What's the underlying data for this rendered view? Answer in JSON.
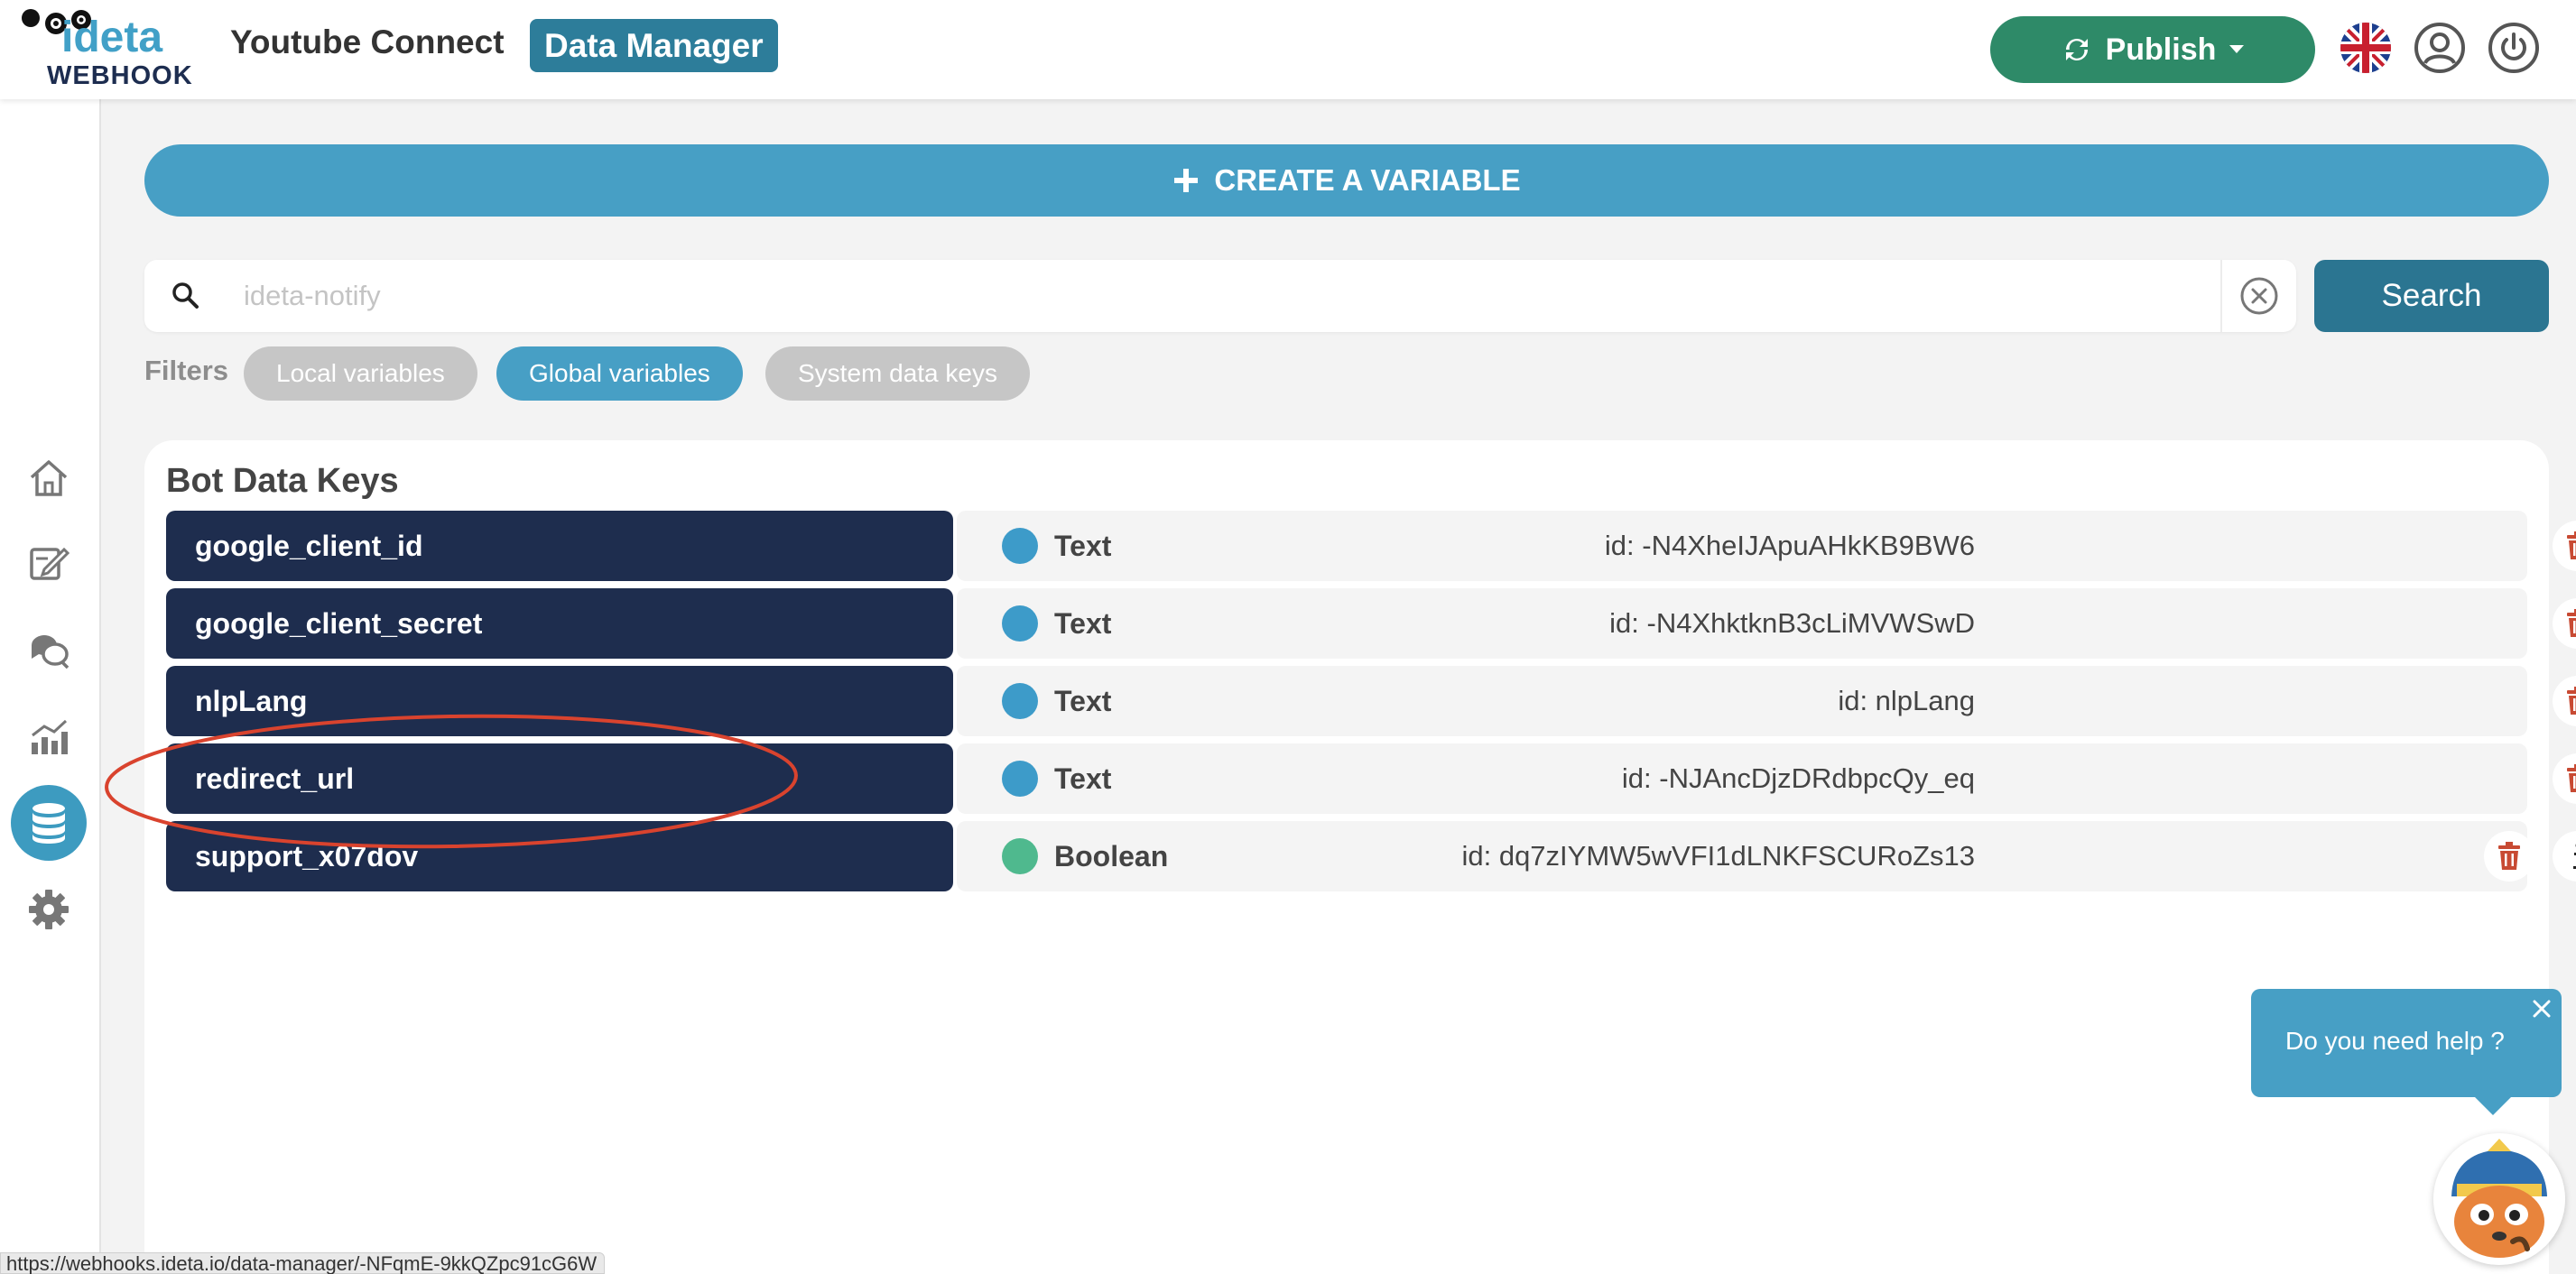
{
  "header": {
    "logo_main": "ideta",
    "logo_sub": "WEBHOOK",
    "app_name": "Youtube Connect",
    "section_badge": "Data Manager",
    "publish_label": "Publish",
    "icons": [
      "refresh-icon",
      "caret-down-icon",
      "uk-flag-icon",
      "user-icon",
      "power-icon"
    ]
  },
  "sidebar": {
    "items": [
      {
        "icon": "home-icon",
        "active": false
      },
      {
        "icon": "edit-icon",
        "active": false
      },
      {
        "icon": "chat-bubbles-icon",
        "active": false
      },
      {
        "icon": "analytics-icon",
        "active": false
      },
      {
        "icon": "database-icon",
        "active": true
      },
      {
        "icon": "gear-icon",
        "active": false
      }
    ]
  },
  "main": {
    "create_label": "CREATE A VARIABLE",
    "search": {
      "placeholder": "ideta-notify",
      "value": "",
      "button_label": "Search"
    },
    "filters": {
      "label": "Filters",
      "chips": [
        {
          "label": "Local variables",
          "active": false
        },
        {
          "label": "Global variables",
          "active": true
        },
        {
          "label": "System data keys",
          "active": false
        }
      ]
    }
  },
  "panel": {
    "title": "Bot Data Keys",
    "rows": [
      {
        "name": "google_client_id",
        "type": "Text",
        "id_text": "id: -N4XheIJApuAHkKB9BW6",
        "type_color": "#3d9bc9",
        "actions": [
          "delete",
          "search"
        ]
      },
      {
        "name": "google_client_secret",
        "type": "Text",
        "id_text": "id: -N4XhktknB3cLiMVWSwD",
        "type_color": "#3d9bc9",
        "actions": [
          "delete",
          "search"
        ]
      },
      {
        "name": "nlpLang",
        "type": "Text",
        "id_text": "id: nlpLang",
        "type_color": "#3d9bc9",
        "actions": [
          "delete",
          "search"
        ]
      },
      {
        "name": "redirect_url",
        "type": "Text",
        "id_text": "id: -NJAncDjzDRdbpcQy_eq",
        "type_color": "#3d9bc9",
        "actions": [
          "delete",
          "search"
        ]
      },
      {
        "name": "support_x07dov",
        "type": "Boolean",
        "id_text": "id: dq7zIYMW5wVFI1dLNKFSCURoZs13",
        "type_color": "#4fb98e",
        "actions": [
          "delete",
          "info",
          "search"
        ]
      }
    ]
  },
  "help": {
    "text": "Do you need help ?"
  },
  "status_bar": {
    "url": "https://webhooks.ideta.io/data-manager/-NFqmE-9kkQZpc91cG6W"
  },
  "colors": {
    "primary": "#479fc5",
    "dark_blue": "#1e2d4e",
    "publish_green": "#2e8a68",
    "search_btn": "#2b7591",
    "delete_red": "#c84a33",
    "annotation_red": "#d9432e"
  }
}
